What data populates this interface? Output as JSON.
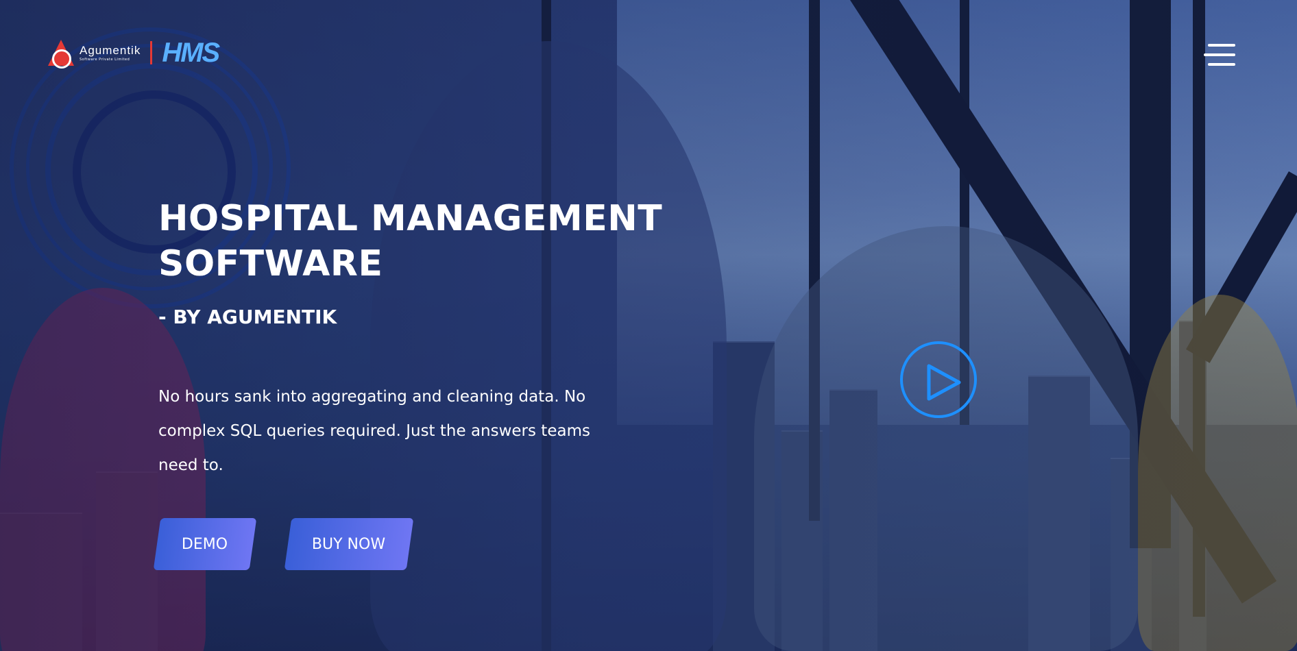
{
  "header": {
    "logo_name": "Agumentik",
    "logo_subtext": "Software Private Limited",
    "logo_product": "HMS",
    "menu_icon": "hamburger-menu-icon"
  },
  "hero": {
    "title_line1": "HOSPITAL MANAGEMENT",
    "title_line2": "SOFTWARE",
    "byline": "- BY AGUMENTIK",
    "description": "No hours sank into aggregating and cleaning data. No complex SQL queries required. Just the answers teams need to.",
    "demo_label": "DEMO",
    "buy_label": "BUY NOW",
    "play_icon": "play-video-icon"
  },
  "colors": {
    "button_gradient_start": "#3a5fd8",
    "button_gradient_end": "#6f76f3",
    "play_ring": "#1e90ff",
    "logo_red": "#e53935"
  }
}
